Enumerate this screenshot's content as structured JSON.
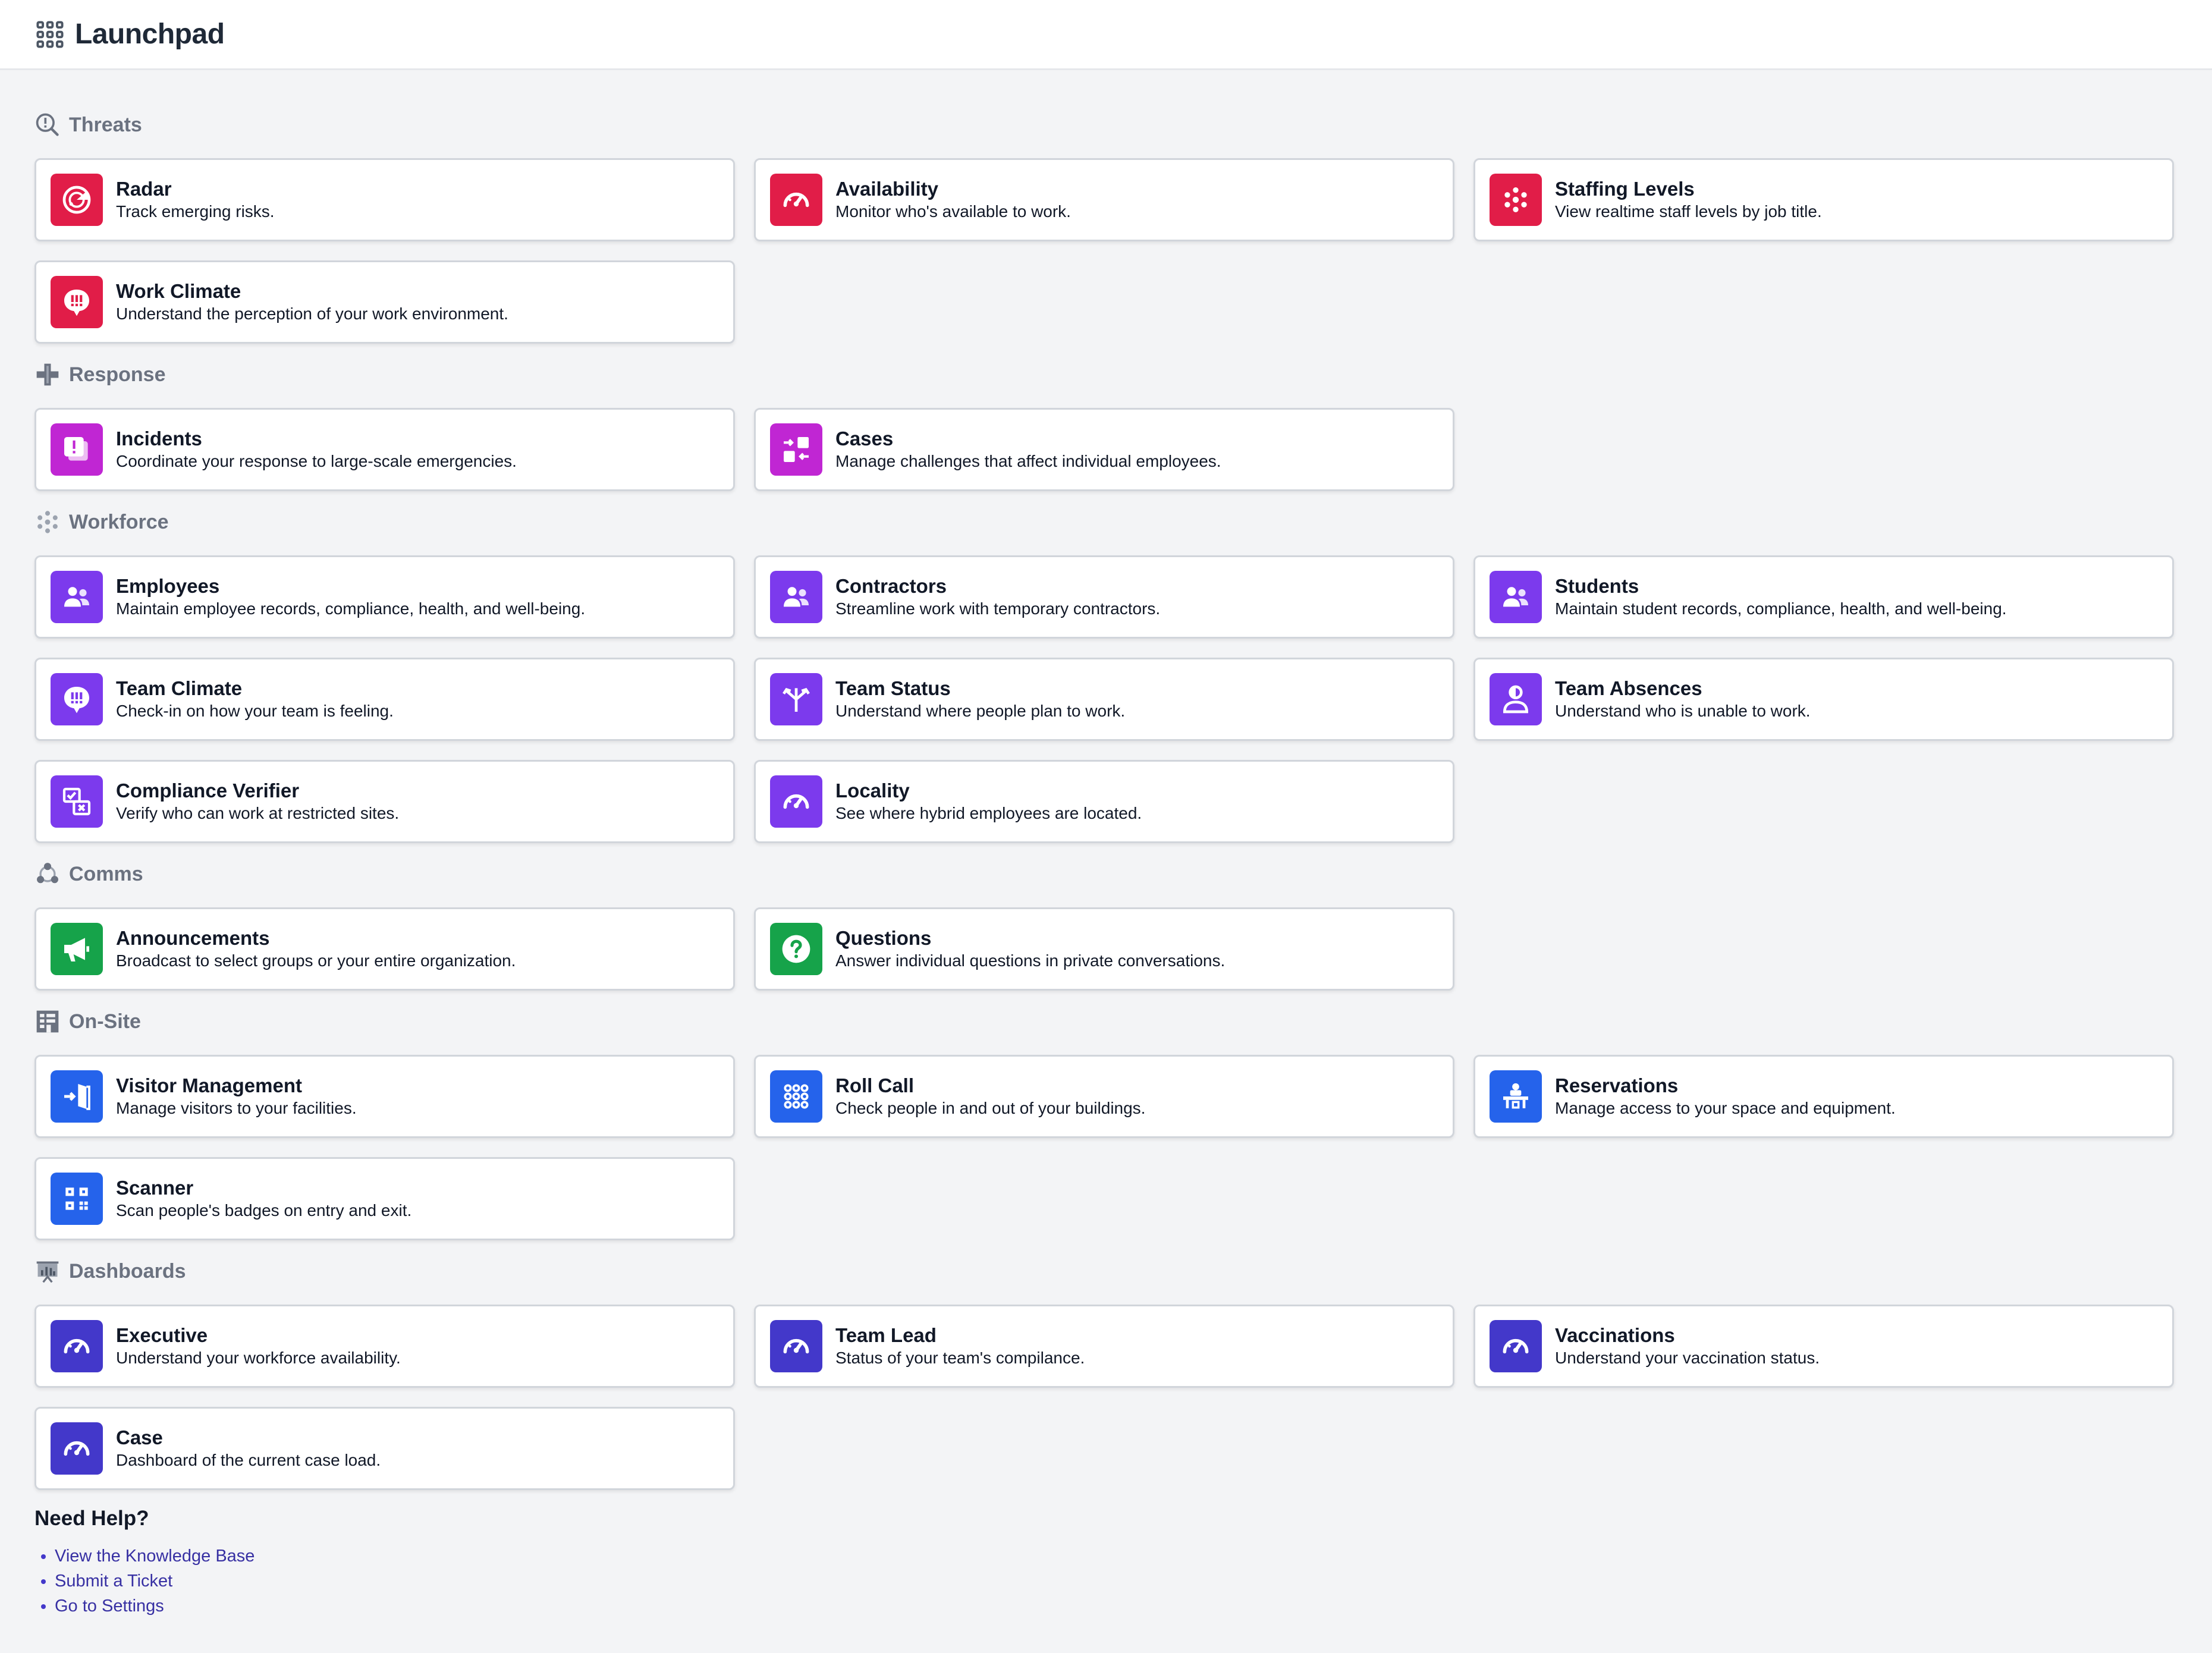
{
  "header": {
    "title": "Launchpad",
    "icon": "grid-icon"
  },
  "colors": {
    "red": "#e11d48",
    "magenta": "#c026d3",
    "violet": "#7c3aed",
    "green": "#16a34a",
    "blue": "#2563eb",
    "indigo": "#4338ca",
    "link": "#3730a3"
  },
  "sections": {
    "threats": {
      "title": "Threats",
      "icon": "alert-magnifier-icon",
      "items": [
        {
          "title": "Radar",
          "desc": "Track emerging risks.",
          "icon": "radar-icon"
        },
        {
          "title": "Availability",
          "desc": "Monitor who's available to work.",
          "icon": "gauge-icon"
        },
        {
          "title": "Staffing Levels",
          "desc": "View realtime staff levels by job title.",
          "icon": "dots-cluster-icon"
        },
        {
          "title": "Work Climate",
          "desc": "Understand the perception of your work environment.",
          "icon": "chat-alert-icon"
        }
      ]
    },
    "response": {
      "title": "Response",
      "icon": "plus-cross-icon",
      "items": [
        {
          "title": "Incidents",
          "desc": "Coordinate your response to large-scale emergencies.",
          "icon": "alert-cards-icon"
        },
        {
          "title": "Cases",
          "desc": "Manage challenges that affect individual employees.",
          "icon": "transfer-boxes-icon"
        }
      ]
    },
    "workforce": {
      "title": "Workforce",
      "icon": "dots-cluster-icon",
      "items": [
        {
          "title": "Employees",
          "desc": "Maintain employee records, compliance, health, and well-being.",
          "icon": "users-icon"
        },
        {
          "title": "Contractors",
          "desc": "Streamline work with temporary contractors.",
          "icon": "users-icon"
        },
        {
          "title": "Students",
          "desc": "Maintain student records, compliance, health, and well-being.",
          "icon": "users-icon"
        },
        {
          "title": "Team Climate",
          "desc": "Check-in on how your team is feeling.",
          "icon": "chat-alert-icon"
        },
        {
          "title": "Team Status",
          "desc": "Understand where people plan to work.",
          "icon": "split-arrows-icon"
        },
        {
          "title": "Team Absences",
          "desc": "Understand who is unable to work.",
          "icon": "user-half-icon"
        },
        {
          "title": "Compliance Verifier",
          "desc": "Verify who can work at restricted sites.",
          "icon": "verify-boxes-icon"
        },
        {
          "title": "Locality",
          "desc": "See where hybrid employees are located.",
          "icon": "gauge-icon"
        }
      ]
    },
    "comms": {
      "title": "Comms",
      "icon": "triad-circles-icon",
      "items": [
        {
          "title": "Announcements",
          "desc": "Broadcast to select groups or your entire organization.",
          "icon": "megaphone-icon"
        },
        {
          "title": "Questions",
          "desc": "Answer individual questions in private conversations.",
          "icon": "question-circle-icon"
        }
      ]
    },
    "onsite": {
      "title": "On-Site",
      "icon": "building-icon",
      "items": [
        {
          "title": "Visitor Management",
          "desc": "Manage visitors to your facilities.",
          "icon": "door-enter-icon"
        },
        {
          "title": "Roll Call",
          "desc": "Check people in and out of your buildings.",
          "icon": "dot-grid-icon"
        },
        {
          "title": "Reservations",
          "desc": "Manage access to your space and equipment.",
          "icon": "desk-icon"
        },
        {
          "title": "Scanner",
          "desc": "Scan people's badges on entry and exit.",
          "icon": "qr-code-icon"
        }
      ]
    },
    "dashboards": {
      "title": "Dashboards",
      "icon": "presentation-icon",
      "items": [
        {
          "title": "Executive",
          "desc": "Understand your workforce availability.",
          "icon": "gauge-icon"
        },
        {
          "title": "Team Lead",
          "desc": "Status of your team's compilance.",
          "icon": "gauge-icon"
        },
        {
          "title": "Vaccinations",
          "desc": "Understand your vaccination status.",
          "icon": "gauge-icon"
        },
        {
          "title": "Case",
          "desc": "Dashboard of the current case load.",
          "icon": "gauge-icon"
        }
      ]
    }
  },
  "help": {
    "title": "Need Help?",
    "links": [
      "View the Knowledge Base",
      "Submit a Ticket",
      "Go to Settings"
    ]
  }
}
